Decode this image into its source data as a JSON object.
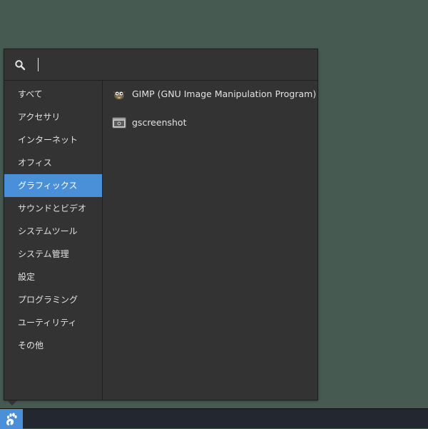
{
  "search": {
    "placeholder": "",
    "value": ""
  },
  "categories": [
    {
      "label": "すべて",
      "selected": false
    },
    {
      "label": "アクセサリ",
      "selected": false
    },
    {
      "label": "インターネット",
      "selected": false
    },
    {
      "label": "オフィス",
      "selected": false
    },
    {
      "label": "グラフィックス",
      "selected": true
    },
    {
      "label": "サウンドとビデオ",
      "selected": false
    },
    {
      "label": "システムツール",
      "selected": false
    },
    {
      "label": "システム管理",
      "selected": false
    },
    {
      "label": "設定",
      "selected": false
    },
    {
      "label": "プログラミング",
      "selected": false
    },
    {
      "label": "ユーティリティ",
      "selected": false
    },
    {
      "label": "その他",
      "selected": false
    }
  ],
  "apps": [
    {
      "label": "GIMP (GNU Image Manipulation Program)",
      "icon": "gimp-icon"
    },
    {
      "label": "gscreenshot",
      "icon": "gscreenshot-icon"
    }
  ],
  "colors": {
    "desktop": "#465a51",
    "menu_bg": "#333333",
    "selected": "#4a90d9",
    "taskbar": "#232830"
  },
  "taskbar": {
    "start_icon": "gnome-foot-icon"
  }
}
